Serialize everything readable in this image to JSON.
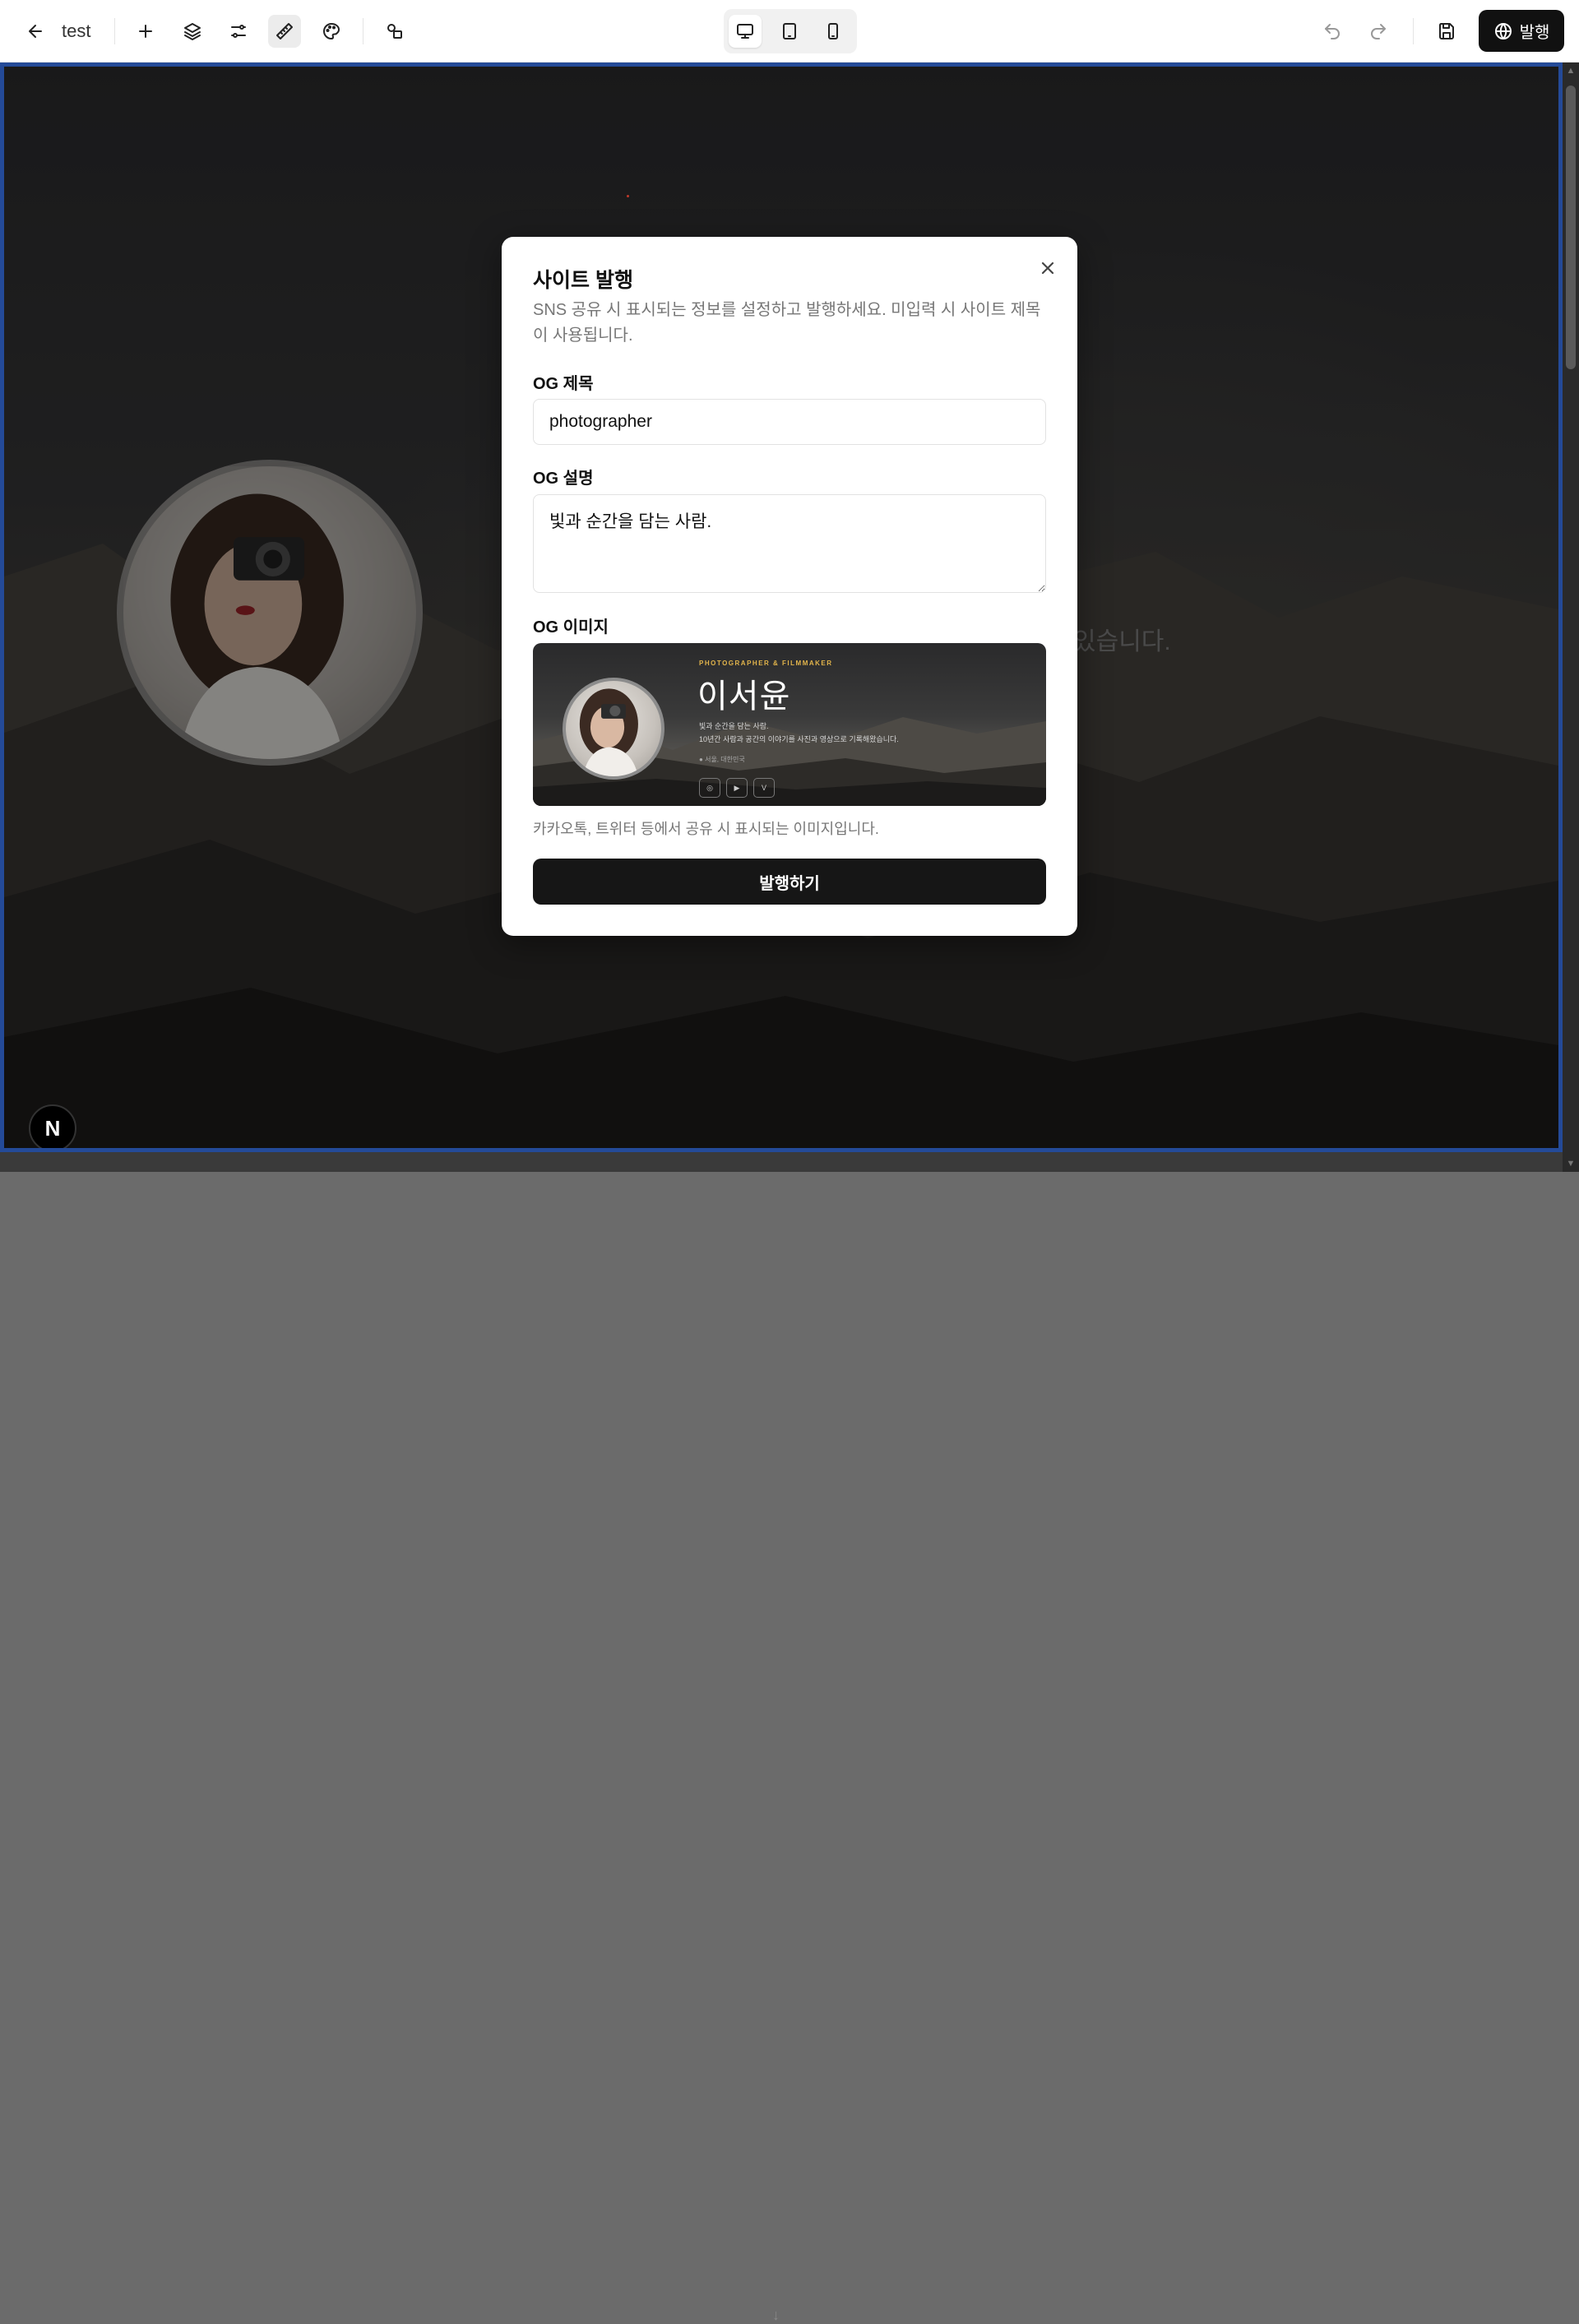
{
  "toolbar": {
    "back_icon": "arrow-left-icon",
    "project_name": "test",
    "icons": [
      "plus-icon",
      "layers-icon",
      "sliders-icon",
      "ruler-icon",
      "palette-icon",
      "shapes-icon"
    ],
    "devices": [
      "desktop-icon",
      "tablet-icon",
      "mobile-icon"
    ],
    "active_device": "desktop",
    "undo_icon": "undo-icon",
    "redo_icon": "redo-icon",
    "save_icon": "save-icon",
    "publish_label": "발행"
  },
  "canvas": {
    "background_text": "있습니다.",
    "badge_letter": "N"
  },
  "modal": {
    "title": "사이트 발행",
    "description": "SNS 공유 시 표시되는 정보를 설정하고 발행하세요. 미입력 시 사이트 제목이 사용됩니다.",
    "og_title_label": "OG 제목",
    "og_title_value": "photographer",
    "og_desc_label": "OG 설명",
    "og_desc_value": "빛과 순간을 담는 사람.",
    "og_image_label": "OG 이미지",
    "og_image": {
      "kicker": "PHOTOGRAPHER & FILMMAKER",
      "name": "이서윤",
      "line1": "빛과 순간을 담는 사람.",
      "line2": "10년간 사람과 공간의 이야기를 사진과 영상으로 기록해왔습니다.",
      "location": "서울, 대한민국",
      "social_icons": [
        "instagram-icon",
        "youtube-icon",
        "vimeo-icon"
      ]
    },
    "helper_text": "카카오톡, 트위터 등에서 공유 시 표시되는 이미지입니다.",
    "submit_label": "발행하기"
  },
  "colors": {
    "canvas_border": "#244a98",
    "primary_button": "#161616",
    "og_accent": "#e3b54b"
  }
}
